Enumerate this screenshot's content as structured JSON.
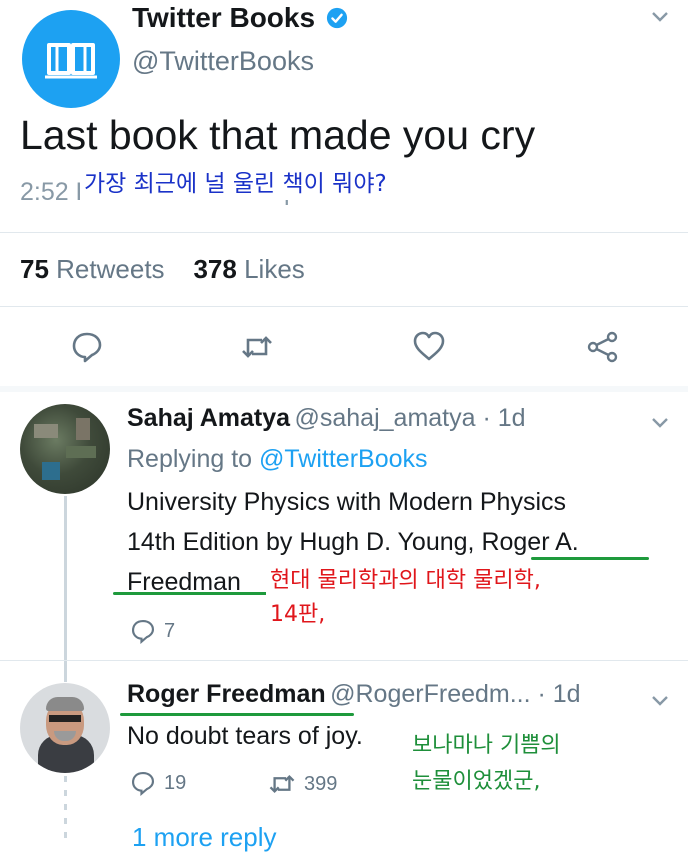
{
  "tweet": {
    "account_name": "Twitter Books",
    "handle": "@TwitterBooks",
    "text": "Last book that made you cry",
    "meta": "2:52 PM · 27 Jan 20 · Sprinklr",
    "translation": "가장 최근에 널 울린 책이 뭐야?",
    "retweets_count": "75",
    "retweets_label": "Retweets",
    "likes_count": "378",
    "likes_label": "Likes"
  },
  "replies": [
    {
      "name": "Sahaj Amatya",
      "handle_time": "@sahaj_amatya · 1d",
      "replying_prefix": "Replying to",
      "replying_to": "@TwitterBooks",
      "line1": "University Physics with Modern Physics",
      "line2a": "14th Edition by Hugh D. Young, ",
      "line2b": "Roger A.",
      "line3": "Freedman",
      "annotation_line1": "현대 물리학과의 대학 물리학,",
      "annotation_line2": "14판,",
      "reply_count": "7"
    },
    {
      "name": "Roger Freedman",
      "handle_time": "@RogerFreedm... · 1d",
      "text": "No doubt tears of joy.",
      "annotation_line1": "보나마나 기쁨의",
      "annotation_line2": "눈물이었겠군,",
      "reply_count": "19",
      "retweet_count": "399"
    }
  ],
  "more_replies": "1 more reply",
  "colors": {
    "twitter_blue": "#1da1f2",
    "annotation_red": "#e0161b",
    "annotation_green": "#1e8f3a",
    "annotation_blue": "#1a32c8"
  }
}
